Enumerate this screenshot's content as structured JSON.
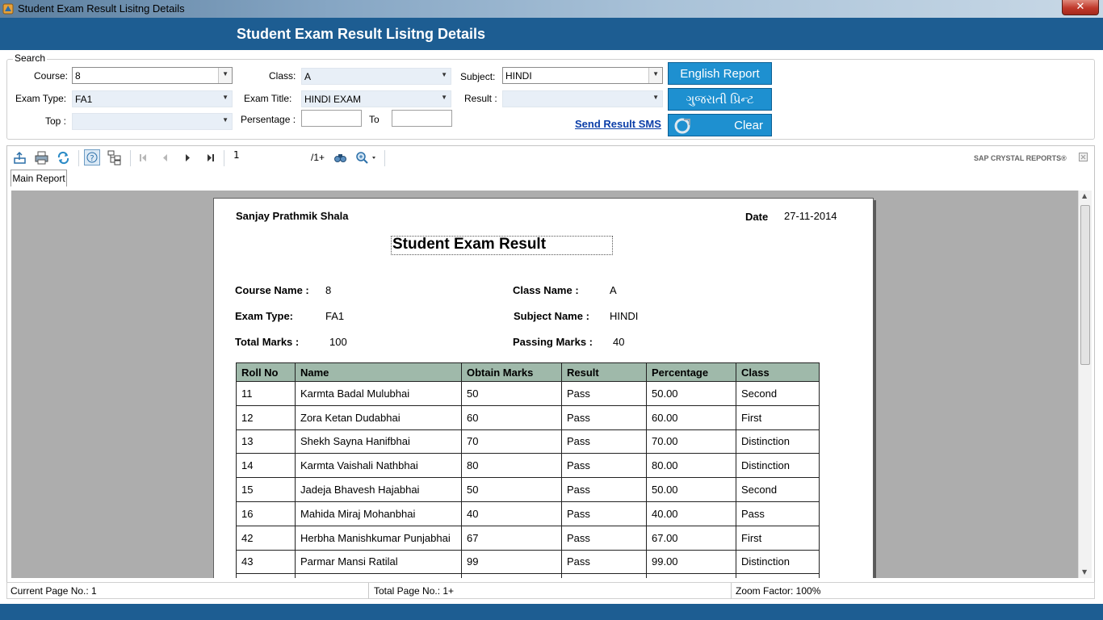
{
  "window": {
    "title": "Student Exam Result Lisitng Details",
    "close_glyph": "✕"
  },
  "header": {
    "title": "Student Exam Result Lisitng Details"
  },
  "search": {
    "legend": "Search",
    "course_label": "Course:",
    "course_value": "8",
    "class_label": "Class:",
    "class_value": "A",
    "subject_label": "Subject:",
    "subject_value": "HINDI",
    "exam_type_label": "Exam Type:",
    "exam_type_value": "FA1",
    "exam_title_label": "Exam Title:",
    "exam_title_value": "HINDI EXAM",
    "result_label": "Result :",
    "result_value": "",
    "top_label": "Top :",
    "top_value": "",
    "percentage_label": "Persentage :",
    "percentage_from": "",
    "to_label": "To",
    "percentage_to": "",
    "english_report_label": "English Report",
    "gujarati_print_label": "ગુજરાતી પ્રિન્ટ",
    "clear_label": "Clear",
    "send_sms_label": "Send Result SMS"
  },
  "viewer": {
    "page_value": "1",
    "page_count": "/1+",
    "brand": "SAP CRYSTAL REPORTS®",
    "tab_label": "Main Report",
    "icons": [
      "export-icon",
      "print-icon",
      "refresh-icon",
      "help-icon",
      "group-tree-icon",
      "first-page-icon",
      "prev-page-icon",
      "next-page-icon",
      "last-page-icon",
      "find-icon",
      "zoom-icon"
    ]
  },
  "report": {
    "school": "Sanjay Prathmik Shala",
    "date_label": "Date",
    "date_value": "27-11-2014",
    "title": "Student Exam  Result",
    "course_name_label": "Course Name :",
    "course_name_value": "8",
    "class_name_label": "Class Name :",
    "class_name_value": "A",
    "exam_type_label": "Exam Type:",
    "exam_type_value": "FA1",
    "subject_name_label": "Subject Name :",
    "subject_name_value": "HINDI",
    "total_marks_label": "Total Marks :",
    "total_marks_value": "100",
    "passing_marks_label": "Passing Marks :",
    "passing_marks_value": "40",
    "columns": [
      "Roll No",
      "Name",
      "Obtain Marks",
      "Result",
      "Percentage",
      "Class"
    ],
    "rows": [
      [
        "11",
        "Karmta Badal Mulubhai",
        "50",
        "Pass",
        "50.00",
        "Second"
      ],
      [
        "12",
        "Zora Ketan Dudabhai",
        "60",
        "Pass",
        "60.00",
        "First"
      ],
      [
        "13",
        "Shekh Sayna Hanifbhai",
        "70",
        "Pass",
        "70.00",
        "Distinction"
      ],
      [
        "14",
        "Karmta Vaishali Nathbhai",
        "80",
        "Pass",
        "80.00",
        "Distinction"
      ],
      [
        "15",
        "Jadeja Bhavesh Hajabhai",
        "50",
        "Pass",
        "50.00",
        "Second"
      ],
      [
        "16",
        "Mahida Miraj Mohanbhai",
        "40",
        "Pass",
        "40.00",
        "Pass"
      ],
      [
        "42",
        "Herbha Manishkumar Punjabhai",
        "67",
        "Pass",
        "67.00",
        "First"
      ],
      [
        "43",
        "Parmar Mansi Ratilal",
        "99",
        "Pass",
        "99.00",
        "Distinction"
      ],
      [
        "",
        "",
        "",
        "",
        "",
        ""
      ]
    ]
  },
  "status": {
    "current_page": "Current Page No.: 1",
    "total_page": "Total Page No.: 1+",
    "zoom": "Zoom Factor: 100%"
  },
  "colors": {
    "header": "#1d5d92",
    "button": "#1e90d0",
    "table_header": "#9fb9aa",
    "link": "#0b3ea8"
  }
}
